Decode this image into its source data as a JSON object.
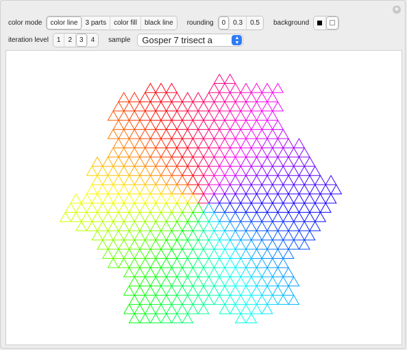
{
  "controls": {
    "color_mode": {
      "label": "color mode",
      "options": [
        "color line",
        "3 parts",
        "color fill",
        "black line"
      ],
      "selected": 0
    },
    "rounding": {
      "label": "rounding",
      "options": [
        "0",
        "0.3",
        "0.5"
      ],
      "selected": 0
    },
    "background": {
      "label": "background",
      "options": [
        "black-swatch",
        "white-swatch"
      ],
      "selected": 1
    },
    "iteration_level": {
      "label": "iteration level",
      "options": [
        "1",
        "2",
        "3",
        "4"
      ],
      "selected": 2
    },
    "sample": {
      "label": "sample",
      "value": "Gosper 7 trisect a"
    }
  },
  "icons": {
    "add": "plus-icon",
    "dropdown": "chevron-updown-icon"
  }
}
